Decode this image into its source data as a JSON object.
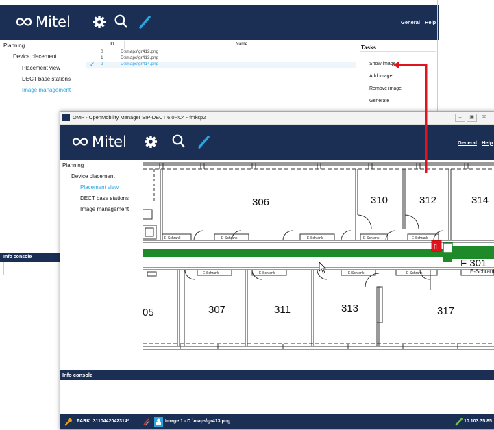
{
  "back_window": {
    "brand": "Mitel",
    "nav": {
      "general": "General",
      "help": "Help"
    },
    "sidebar": [
      {
        "label": "Planning"
      },
      {
        "label": "Device placement"
      },
      {
        "label": "Placement view"
      },
      {
        "label": "DECT base stations"
      },
      {
        "label": "Image management"
      }
    ],
    "table": {
      "headers": {
        "id": "ID",
        "name": "Name"
      },
      "rows": [
        {
          "id": "0",
          "name": "D:\\maps\\gr412.png",
          "checked": false
        },
        {
          "id": "1",
          "name": "D:\\maps\\gr413.png",
          "checked": false
        },
        {
          "id": "2",
          "name": "D:\\maps\\gr414.png",
          "checked": true
        }
      ]
    },
    "tasks": {
      "title": "Tasks",
      "items": [
        "Show image",
        "Add image",
        "Remove image",
        "Generate"
      ]
    },
    "info_console": "Info console"
  },
  "front_window": {
    "title": "OMP - OpenMobility Manager SIP-DECT 6.0RC4 - fmksp2",
    "brand": "Mitel",
    "nav": {
      "general": "General",
      "help": "Help"
    },
    "sidebar": [
      {
        "label": "Planning"
      },
      {
        "label": "Device placement"
      },
      {
        "label": "Placement view"
      },
      {
        "label": "DECT base stations"
      },
      {
        "label": "Image management"
      }
    ],
    "floor_plan": {
      "rooms_top": [
        "306",
        "310",
        "312",
        "314"
      ],
      "rooms_bottom": [
        "05",
        "307",
        "311",
        "313",
        "317"
      ],
      "corridor_label": "F 301",
      "cabinet_label": "E-Schrank"
    },
    "info_console": "Info console",
    "status": {
      "park": "PARK: 3110442042314*",
      "image": "Image 1 - D:\\maps\\gr413.png",
      "ip": "10.103.35.85"
    }
  },
  "colors": {
    "navy": "#1b2f54",
    "accent_blue": "#2aa3df",
    "arrow_red": "#e0141e",
    "corridor_green": "#1e8a2a"
  }
}
